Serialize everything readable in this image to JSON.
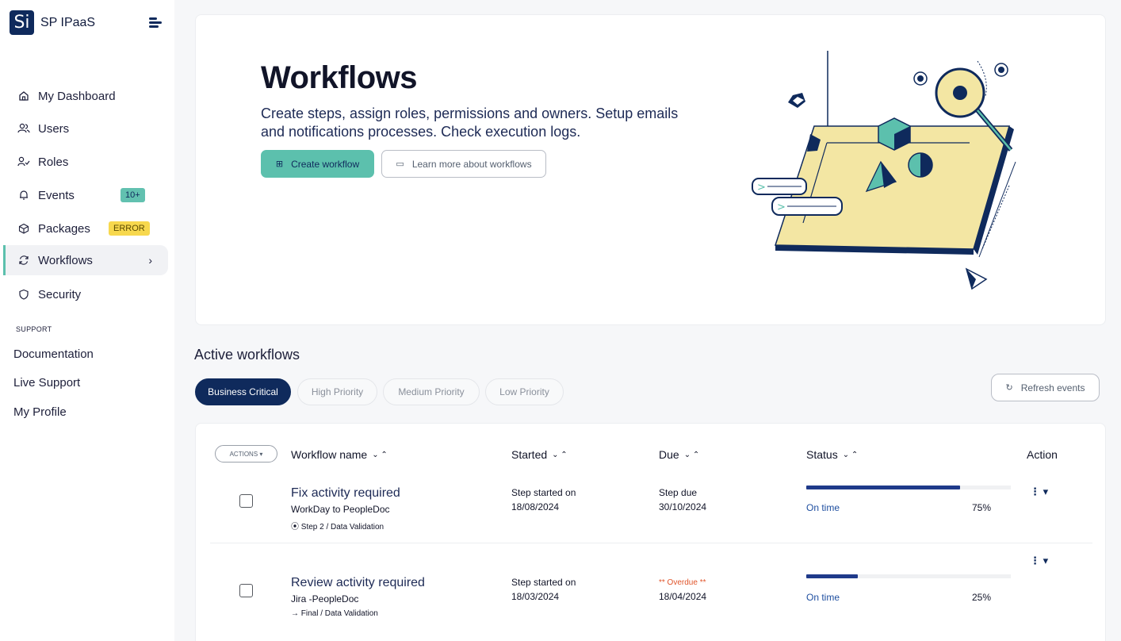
{
  "app": {
    "logo": "Si",
    "name": "SP IPaaS"
  },
  "sidebar": {
    "items": [
      {
        "label": "My Dashboard",
        "icon": "home-icon"
      },
      {
        "label": "Users",
        "icon": "users-icon"
      },
      {
        "label": "Roles",
        "icon": "roles-icon"
      },
      {
        "label": "Events",
        "icon": "bell-icon",
        "badge": "10+"
      },
      {
        "label": "Packages",
        "icon": "package-icon",
        "badge": "ERROR"
      },
      {
        "label": "Workflows",
        "icon": "refresh-icon",
        "active": true
      },
      {
        "label": "Security",
        "icon": "shield-icon"
      }
    ],
    "support_heading": "SUPPORT",
    "support_links": [
      "Documentation",
      "Live Support",
      "My Profile"
    ]
  },
  "hero": {
    "title": "Workflows",
    "description": "Create steps, assign roles, permissions and owners. Setup emails and notifications processes. Check execution logs.",
    "primary_button": "Create workflow",
    "secondary_button": "Learn more about workflows"
  },
  "active": {
    "title": "Active workflows",
    "filters": [
      "Business Critical",
      "High Priority",
      "Medium Priority",
      "Low Priority"
    ],
    "selected_filter": "Business Critical",
    "refresh_label": "Refresh events"
  },
  "table": {
    "actions_label": "ACTIONS ▾",
    "columns": [
      "Workflow name",
      "Started",
      "Due",
      "Status",
      "Action"
    ],
    "rows": [
      {
        "name": "Fix activity required",
        "integration": "WorkDay to PeopleDoc",
        "step": "⦿ Step 2 / Data Validation",
        "started_label": "Step started on",
        "started_date": "18/08/2024",
        "due_label": "Step due",
        "due_date": "30/10/2024",
        "status": "On time",
        "progress": 75,
        "progress_label": "75%"
      },
      {
        "name": "Review activity required",
        "integration": "Jira -PeopleDoc",
        "step": "→ Final / Data Validation",
        "started_label": "Step started on",
        "started_date": "18/03/2024",
        "due_label": "** Overdue **",
        "due_date": "18/04/2024",
        "status": "On time",
        "progress": 25,
        "progress_label": "25%"
      }
    ]
  },
  "colors": {
    "brand": "#0f2a5c",
    "accent": "#5cc0ad",
    "warning": "#f7d84e",
    "overdue": "#e0552b"
  }
}
